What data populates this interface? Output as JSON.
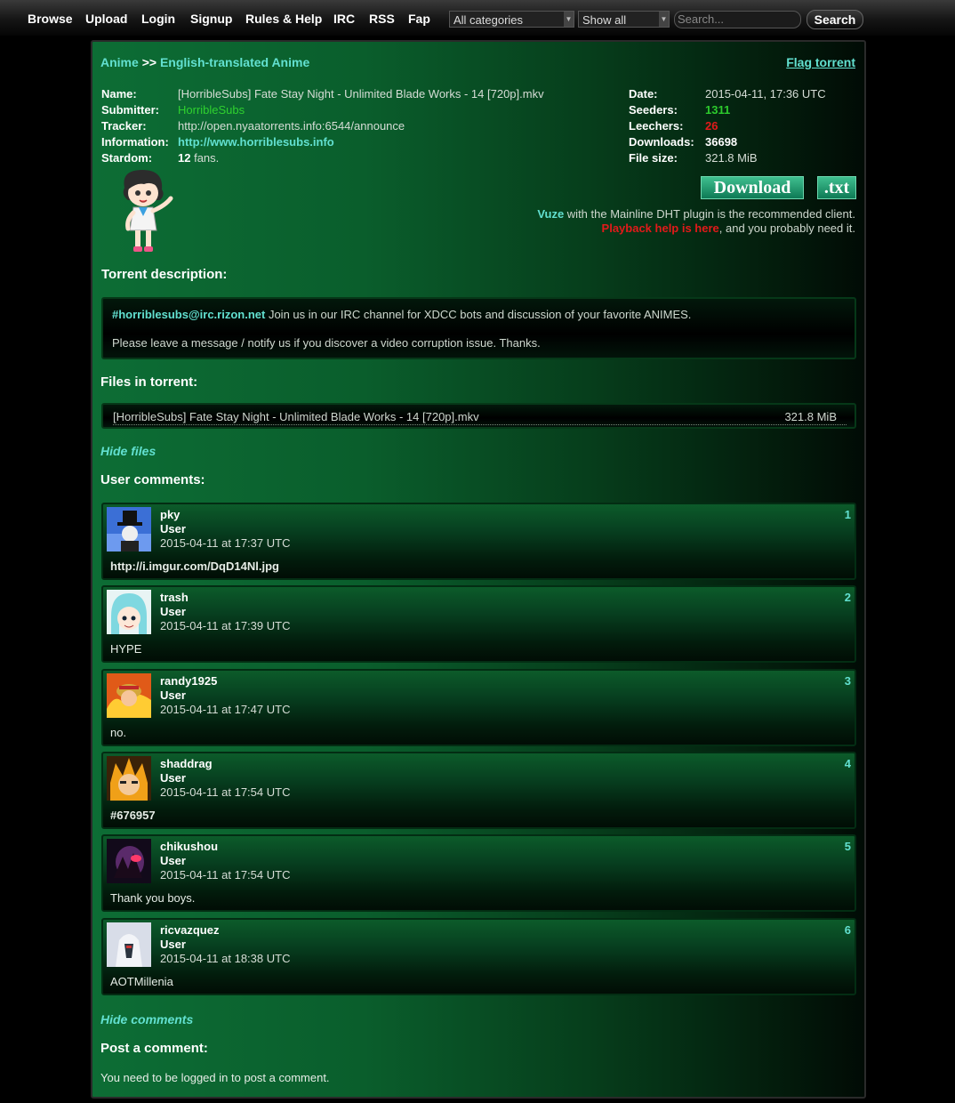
{
  "nav": {
    "items": [
      "Browse",
      "Upload",
      "Login",
      "Signup",
      "Rules & Help",
      "IRC",
      "RSS",
      "Fap"
    ],
    "category_select": "All categories",
    "filter_select": "Show all",
    "search_placeholder": "Search...",
    "search_button": "Search"
  },
  "breadcrumb": {
    "category": "Anime",
    "separator": ">>",
    "subcategory": "English-translated Anime"
  },
  "flag_link": "Flag torrent",
  "info": {
    "name_label": "Name:",
    "name": "[HorribleSubs] Fate Stay Night - Unlimited Blade Works - 14 [720p].mkv",
    "submitter_label": "Submitter:",
    "submitter": "HorribleSubs",
    "tracker_label": "Tracker:",
    "tracker": "http://open.nyaatorrents.info:6544/announce",
    "information_label": "Information:",
    "information": "http://www.horriblesubs.info",
    "stardom_label": "Stardom:",
    "stardom_count": "12",
    "stardom_suffix": "fans.",
    "date_label": "Date:",
    "date": "2015-04-11, 17:36 UTC",
    "seeders_label": "Seeders:",
    "seeders": "1311",
    "leechers_label": "Leechers:",
    "leechers": "26",
    "downloads_label": "Downloads:",
    "downloads": "36698",
    "filesize_label": "File size:",
    "filesize": "321.8 MiB"
  },
  "download": {
    "download_button": "Download",
    "txt_button": ".txt",
    "client_name": "Vuze",
    "client_text": "with the Mainline DHT plugin is the recommended client.",
    "playback_link": "Playback help is here",
    "playback_text": ", and you probably need it."
  },
  "description": {
    "heading": "Torrent description:",
    "irc_link": "#horriblesubs@irc.rizon.net",
    "line1": "Join us in our IRC channel for XDCC bots and discussion of your favorite ANIMES.",
    "line2": "Please leave a message / notify us if you discover a video corruption issue. Thanks."
  },
  "files": {
    "heading": "Files in torrent:",
    "list": [
      {
        "name": "[HorribleSubs] Fate Stay Night - Unlimited Blade Works - 14 [720p].mkv",
        "size": "321.8 MiB"
      }
    ],
    "hide_link": "Hide files"
  },
  "comments": {
    "heading": "User comments:",
    "list": [
      {
        "user": "pky",
        "role": "User",
        "time": "2015-04-11 at 17:37 UTC",
        "num": "1",
        "body": "http://i.imgur.com/DqD14Nl.jpg",
        "body_is_link": true,
        "avatar_color": "#3b6fd6"
      },
      {
        "user": "trash",
        "role": "User",
        "time": "2015-04-11 at 17:39 UTC",
        "num": "2",
        "body": "HYPE",
        "body_is_link": false,
        "avatar_color": "#7fd8e0"
      },
      {
        "user": "randy1925",
        "role": "User",
        "time": "2015-04-11 at 17:47 UTC",
        "num": "3",
        "body": "no.",
        "body_is_link": false,
        "avatar_color": "#e05a18"
      },
      {
        "user": "shaddrag",
        "role": "User",
        "time": "2015-04-11 at 17:54 UTC",
        "num": "4",
        "body": "#676957",
        "body_is_link": true,
        "avatar_color": "#f0a018"
      },
      {
        "user": "chikushou",
        "role": "User",
        "time": "2015-04-11 at 17:54 UTC",
        "num": "5",
        "body": "Thank you boys.",
        "body_is_link": false,
        "avatar_color": "#5a2a6a"
      },
      {
        "user": "ricvazquez",
        "role": "User",
        "time": "2015-04-11 at 18:38 UTC",
        "num": "6",
        "body": "AOTMillenia",
        "body_is_link": false,
        "avatar_color": "#d8dde8"
      }
    ],
    "hide_link": "Hide comments"
  },
  "post": {
    "heading": "Post a comment:",
    "note": "You need to be logged in to post a comment."
  }
}
